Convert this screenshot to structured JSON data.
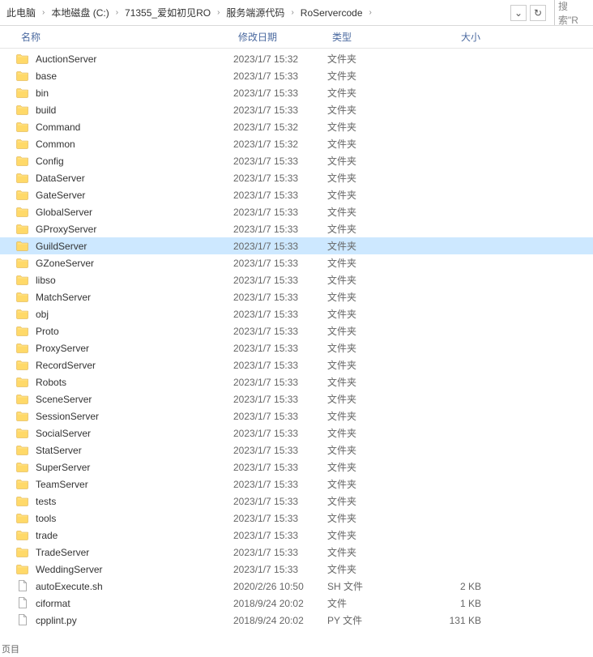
{
  "breadcrumb": {
    "items": [
      "此电脑",
      "本地磁盘 (C:)",
      "71355_爱如初见RO",
      "服务端源代码",
      "RoServercode"
    ],
    "refresh": "↻",
    "dropdown": "⌄",
    "search_placeholder": "搜索\"R"
  },
  "columns": {
    "name": "名称",
    "date": "修改日期",
    "type": "类型",
    "size": "大小"
  },
  "selected_index": 11,
  "files": [
    {
      "name": "AuctionServer",
      "date": "2023/1/7 15:32",
      "type": "文件夹",
      "size": "",
      "kind": "folder"
    },
    {
      "name": "base",
      "date": "2023/1/7 15:33",
      "type": "文件夹",
      "size": "",
      "kind": "folder"
    },
    {
      "name": "bin",
      "date": "2023/1/7 15:33",
      "type": "文件夹",
      "size": "",
      "kind": "folder"
    },
    {
      "name": "build",
      "date": "2023/1/7 15:33",
      "type": "文件夹",
      "size": "",
      "kind": "folder"
    },
    {
      "name": "Command",
      "date": "2023/1/7 15:32",
      "type": "文件夹",
      "size": "",
      "kind": "folder"
    },
    {
      "name": "Common",
      "date": "2023/1/7 15:32",
      "type": "文件夹",
      "size": "",
      "kind": "folder"
    },
    {
      "name": "Config",
      "date": "2023/1/7 15:33",
      "type": "文件夹",
      "size": "",
      "kind": "folder"
    },
    {
      "name": "DataServer",
      "date": "2023/1/7 15:33",
      "type": "文件夹",
      "size": "",
      "kind": "folder"
    },
    {
      "name": "GateServer",
      "date": "2023/1/7 15:33",
      "type": "文件夹",
      "size": "",
      "kind": "folder"
    },
    {
      "name": "GlobalServer",
      "date": "2023/1/7 15:33",
      "type": "文件夹",
      "size": "",
      "kind": "folder"
    },
    {
      "name": "GProxyServer",
      "date": "2023/1/7 15:33",
      "type": "文件夹",
      "size": "",
      "kind": "folder"
    },
    {
      "name": "GuildServer",
      "date": "2023/1/7 15:33",
      "type": "文件夹",
      "size": "",
      "kind": "folder"
    },
    {
      "name": "GZoneServer",
      "date": "2023/1/7 15:33",
      "type": "文件夹",
      "size": "",
      "kind": "folder"
    },
    {
      "name": "libso",
      "date": "2023/1/7 15:33",
      "type": "文件夹",
      "size": "",
      "kind": "folder"
    },
    {
      "name": "MatchServer",
      "date": "2023/1/7 15:33",
      "type": "文件夹",
      "size": "",
      "kind": "folder"
    },
    {
      "name": "obj",
      "date": "2023/1/7 15:33",
      "type": "文件夹",
      "size": "",
      "kind": "folder"
    },
    {
      "name": "Proto",
      "date": "2023/1/7 15:33",
      "type": "文件夹",
      "size": "",
      "kind": "folder"
    },
    {
      "name": "ProxyServer",
      "date": "2023/1/7 15:33",
      "type": "文件夹",
      "size": "",
      "kind": "folder"
    },
    {
      "name": "RecordServer",
      "date": "2023/1/7 15:33",
      "type": "文件夹",
      "size": "",
      "kind": "folder"
    },
    {
      "name": "Robots",
      "date": "2023/1/7 15:33",
      "type": "文件夹",
      "size": "",
      "kind": "folder"
    },
    {
      "name": "SceneServer",
      "date": "2023/1/7 15:33",
      "type": "文件夹",
      "size": "",
      "kind": "folder"
    },
    {
      "name": "SessionServer",
      "date": "2023/1/7 15:33",
      "type": "文件夹",
      "size": "",
      "kind": "folder"
    },
    {
      "name": "SocialServer",
      "date": "2023/1/7 15:33",
      "type": "文件夹",
      "size": "",
      "kind": "folder"
    },
    {
      "name": "StatServer",
      "date": "2023/1/7 15:33",
      "type": "文件夹",
      "size": "",
      "kind": "folder"
    },
    {
      "name": "SuperServer",
      "date": "2023/1/7 15:33",
      "type": "文件夹",
      "size": "",
      "kind": "folder"
    },
    {
      "name": "TeamServer",
      "date": "2023/1/7 15:33",
      "type": "文件夹",
      "size": "",
      "kind": "folder"
    },
    {
      "name": "tests",
      "date": "2023/1/7 15:33",
      "type": "文件夹",
      "size": "",
      "kind": "folder"
    },
    {
      "name": "tools",
      "date": "2023/1/7 15:33",
      "type": "文件夹",
      "size": "",
      "kind": "folder"
    },
    {
      "name": "trade",
      "date": "2023/1/7 15:33",
      "type": "文件夹",
      "size": "",
      "kind": "folder"
    },
    {
      "name": "TradeServer",
      "date": "2023/1/7 15:33",
      "type": "文件夹",
      "size": "",
      "kind": "folder"
    },
    {
      "name": "WeddingServer",
      "date": "2023/1/7 15:33",
      "type": "文件夹",
      "size": "",
      "kind": "folder"
    },
    {
      "name": "autoExecute.sh",
      "date": "2020/2/26 10:50",
      "type": "SH 文件",
      "size": "2 KB",
      "kind": "file"
    },
    {
      "name": "ciformat",
      "date": "2018/9/24 20:02",
      "type": "文件",
      "size": "1 KB",
      "kind": "file"
    },
    {
      "name": "cpplint.py",
      "date": "2018/9/24 20:02",
      "type": "PY 文件",
      "size": "131 KB",
      "kind": "file"
    }
  ],
  "footer": "页目"
}
